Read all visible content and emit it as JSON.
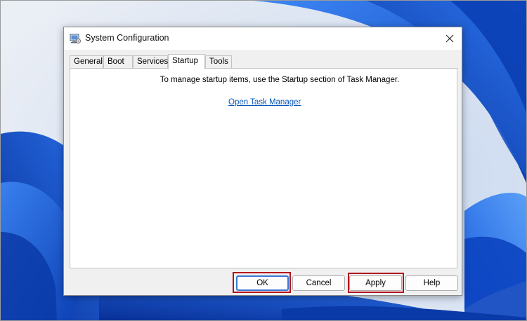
{
  "window": {
    "title": "System Configuration",
    "close_label": "Close"
  },
  "tabs": [
    {
      "label": "General",
      "active": false
    },
    {
      "label": "Boot",
      "active": false
    },
    {
      "label": "Services",
      "active": false
    },
    {
      "label": "Startup",
      "active": true
    },
    {
      "label": "Tools",
      "active": false
    }
  ],
  "startup_panel": {
    "message": "To manage startup items, use the Startup section of Task Manager.",
    "link_text": "Open Task Manager"
  },
  "buttons": {
    "ok": "OK",
    "cancel": "Cancel",
    "apply": "Apply",
    "help": "Help"
  },
  "colors": {
    "highlight": "#b3121d",
    "link": "#0a56b8",
    "wallpaper_blue": "#1156d9"
  },
  "icons": {
    "app": "msconfig-icon",
    "close": "close-icon"
  }
}
